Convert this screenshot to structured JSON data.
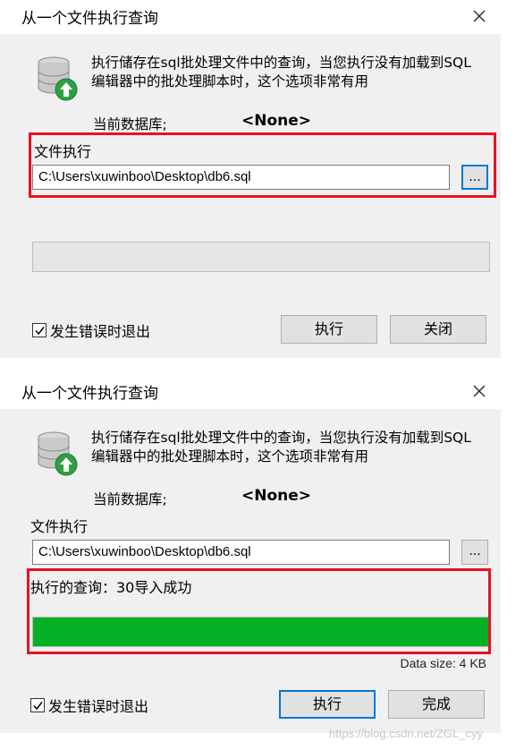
{
  "dialogs": [
    {
      "title": "从一个文件执行查询",
      "description": "执行储存在sql批处理文件中的查询，当您执行没有加载到SQL编辑器中的批处理脚本时，这个选项非常有用",
      "current_db_label": "当前数据库;",
      "current_db_value": "<None>",
      "file_label": "文件执行",
      "file_path": "C:\\Users\\xuwinboo\\Desktop\\db6.sql",
      "browse_label": "...",
      "progress_fraction": 0.0,
      "checkbox_label": "发生错误时退出",
      "checkbox_checked": true,
      "execute_label": "执行",
      "close_label": "关闭"
    },
    {
      "title": "从一个文件执行查询",
      "description": "执行储存在sql批处理文件中的查询，当您执行没有加载到SQL编辑器中的批处理脚本时，这个选项非常有用",
      "current_db_label": "当前数据库;",
      "current_db_value": "<None>",
      "file_label": "文件执行",
      "file_path": "C:\\Users\\xuwinboo\\Desktop\\db6.sql",
      "browse_label": "...",
      "exec_status": "执行的查询：30导入成功",
      "progress_fraction": 1.0,
      "data_size": "Data size: 4 KB",
      "checkbox_label": "发生错误时退出",
      "checkbox_checked": true,
      "execute_label": "执行",
      "close_label": "完成"
    }
  ],
  "watermark": "https://blog.csdn.net/ZGL_cyy",
  "colors": {
    "highlight": "#e81123",
    "progress_fill": "#06b025",
    "focus": "#0078d7"
  },
  "icons": {
    "database": "database-upload-icon",
    "close": "close-icon",
    "check": "checkmark-icon"
  }
}
